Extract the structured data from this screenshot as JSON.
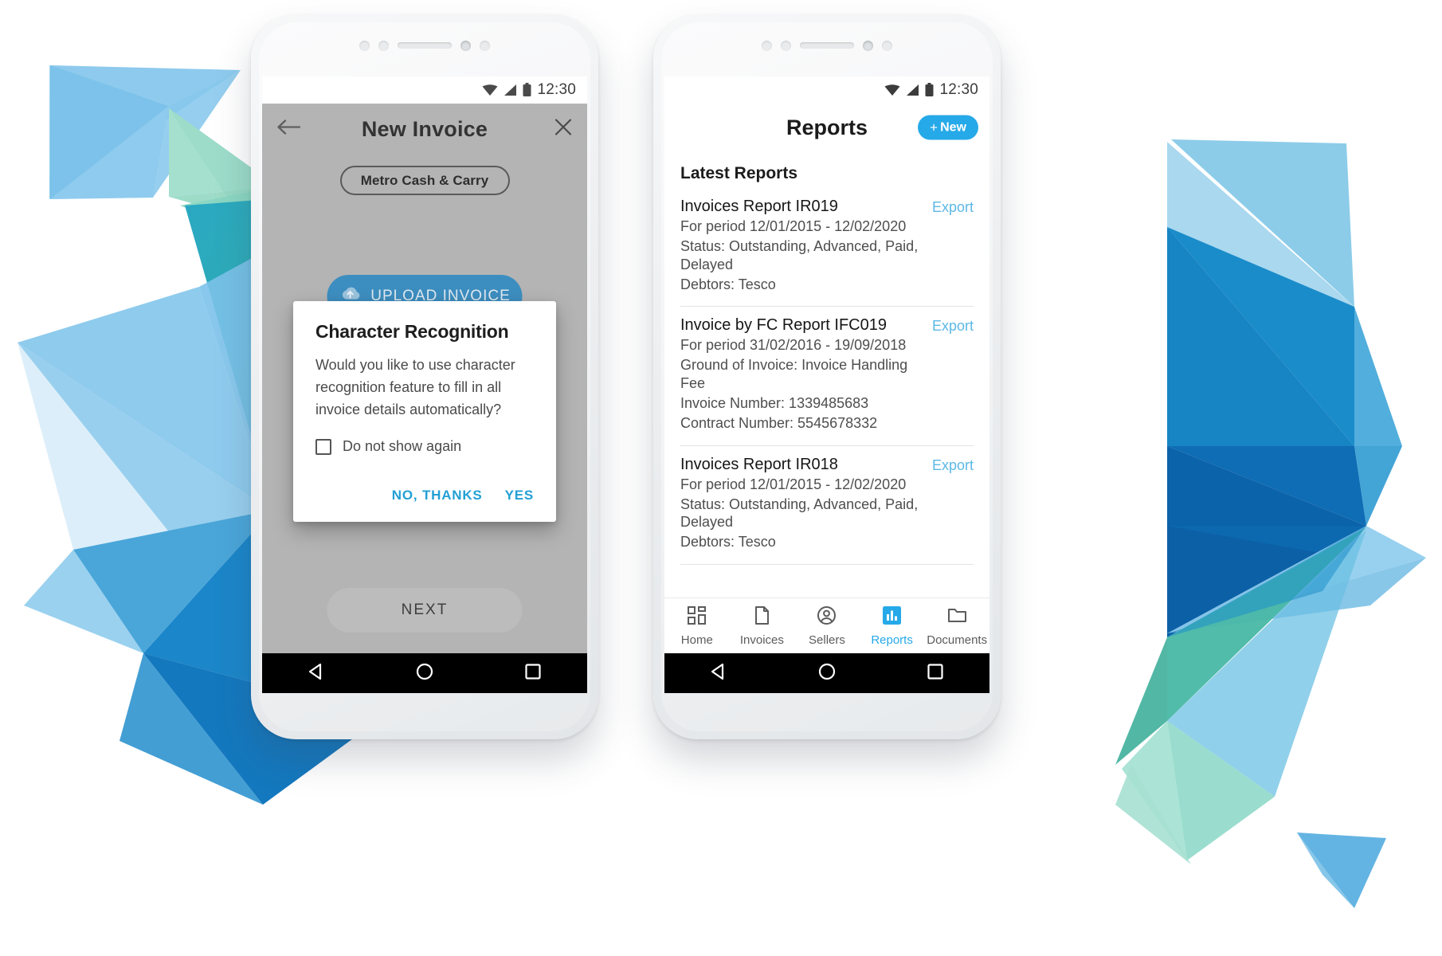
{
  "left_phone": {
    "status_bar": {
      "time": "12:30",
      "wifi_icon": "wifi-icon",
      "signal_icon": "signal-icon",
      "battery_icon": "battery-icon"
    },
    "app_bar": {
      "title": "New Invoice",
      "back_icon": "back-arrow-icon",
      "close_icon": "close-icon"
    },
    "seller_chip": "Metro Cash & Carry",
    "upload_button": {
      "label": "UPLOAD INVOICE",
      "icon": "cloud-upload-icon"
    },
    "next_button": "NEXT",
    "dialog": {
      "title": "Character Recognition",
      "body": "Would you like to use character recognition feature to fill in all invoice details automatically?",
      "checkbox_label": "Do not show again",
      "checkbox_checked": false,
      "decline_label": "NO, THANKS",
      "accept_label": "YES"
    },
    "nav_bar": {
      "back": "back-triangle-icon",
      "home": "home-circle-icon",
      "recents": "recents-square-icon"
    }
  },
  "right_phone": {
    "status_bar": {
      "time": "12:30",
      "wifi_icon": "wifi-icon",
      "signal_icon": "signal-icon",
      "battery_icon": "battery-icon"
    },
    "app_bar": {
      "title": "Reports",
      "new_button": {
        "plus": "+",
        "label": "New"
      }
    },
    "section_title": "Latest Reports",
    "export_label": "Export",
    "reports": [
      {
        "title": "Invoices Report IR019",
        "lines": [
          "For period 12/01/2015 - 12/02/2020",
          "Status: Outstanding, Advanced, Paid, Delayed",
          "Debtors: Tesco"
        ]
      },
      {
        "title": "Invoice by FC Report IFC019",
        "lines": [
          "For period 31/02/2016 - 19/09/2018",
          "Ground of Invoice: Invoice Handling Fee",
          "Invoice Number: 1339485683",
          "Contract Number: 5545678332"
        ]
      },
      {
        "title": "Invoices Report IR018",
        "lines": [
          "For period 12/01/2015 - 12/02/2020",
          "Status: Outstanding, Advanced, Paid, Delayed",
          "Debtors: Tesco"
        ]
      }
    ],
    "tabs": [
      {
        "label": "Home",
        "icon": "grid-icon",
        "active": false
      },
      {
        "label": "Invoices",
        "icon": "document-icon",
        "active": false
      },
      {
        "label": "Sellers",
        "icon": "account-circle-icon",
        "active": false
      },
      {
        "label": "Reports",
        "icon": "bar-chart-icon",
        "active": true
      },
      {
        "label": "Documents",
        "icon": "folder-icon",
        "active": false
      }
    ],
    "nav_bar": {
      "back": "back-triangle-icon",
      "home": "home-circle-icon",
      "recents": "recents-square-icon"
    }
  },
  "colors": {
    "accent_blue": "#26a9e8",
    "link_blue": "#5cb8e6",
    "dialog_action": "#22a0d4",
    "upload_blue": "#3d8ec0",
    "screen_gray": "#b4b4b4"
  }
}
